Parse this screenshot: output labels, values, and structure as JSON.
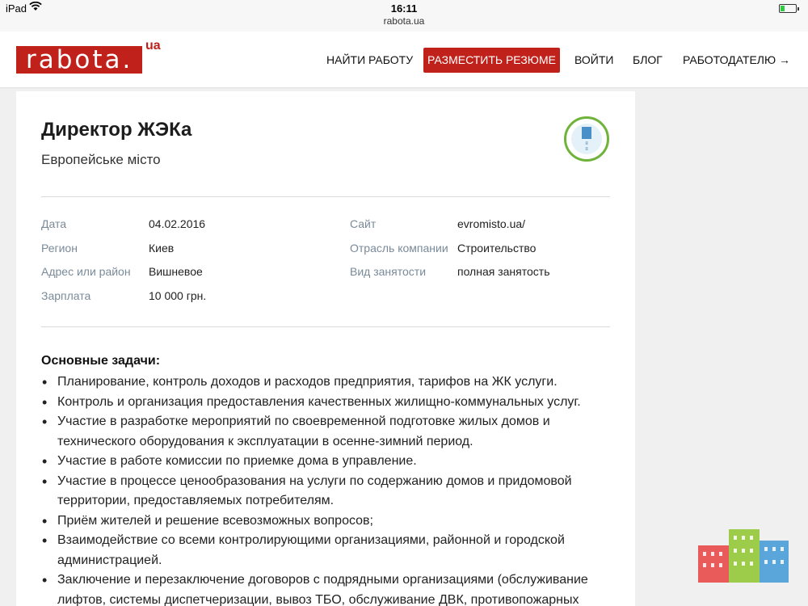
{
  "status_bar": {
    "device": "iPad",
    "wifi_icon": "wifi-icon",
    "time": "16:11",
    "battery_level": 0.25,
    "battery_color": "#2ecc40"
  },
  "browser": {
    "url": "rabota.ua"
  },
  "header": {
    "logo_text": "rabota.",
    "logo_suffix": "ua",
    "brand_color": "#c0211a",
    "nav": {
      "find_job": "НАЙТИ РАБОТУ",
      "post_resume": "РАЗМЕСТИТЬ РЕЗЮМЕ",
      "login": "ВОЙТИ",
      "blog": "БЛОГ",
      "employer": "РАБОТОДАТЕЛЮ →"
    }
  },
  "vacancy": {
    "title": "Директор ЖЭКа",
    "company": "Европейське місто",
    "company_logo_icon": "company-logo-icon",
    "details": {
      "date_label": "Дата",
      "date_value": "04.02.2016",
      "region_label": "Регион",
      "region_value": "Киев",
      "address_label": "Адрес или район",
      "address_value": "Вишневое",
      "salary_label": "Зарплата",
      "salary_value": "10 000 грн.",
      "site_label": "Сайт",
      "site_value": "evromisto.ua/",
      "industry_label": "Отрасль компании",
      "industry_value": "Строительство",
      "employment_label": "Вид занятости",
      "employment_value": "полная занятость"
    },
    "tasks_heading": "Основные задачи:",
    "tasks": [
      "Планирование, контроль доходов и расходов предприятия, тарифов на ЖК услуги.",
      "Контроль и организация предоставления качественных жилищно-коммунальных услуг.",
      "Участие в разработке мероприятий по своевременной подготовке жилых домов и технического оборудования к эксплуатации в осенне-зимний период.",
      "Участие в работе комиссии по приемке дома в управление.",
      "Участие в процессе ценообразования на услуги по содержанию домов и придомовой территории, предоставляемых потребителям.",
      "Приём жителей и решение всевозможных вопросов;",
      "Взаимодействие со всеми контролирующими организациями, районной и городской администрацией.",
      "Заключение и перезаключение договоров с подрядными организациями (обслуживание лифтов, системы диспетчеризации, вывоз ТБО, обслуживание ДВК, противопожарных"
    ]
  }
}
